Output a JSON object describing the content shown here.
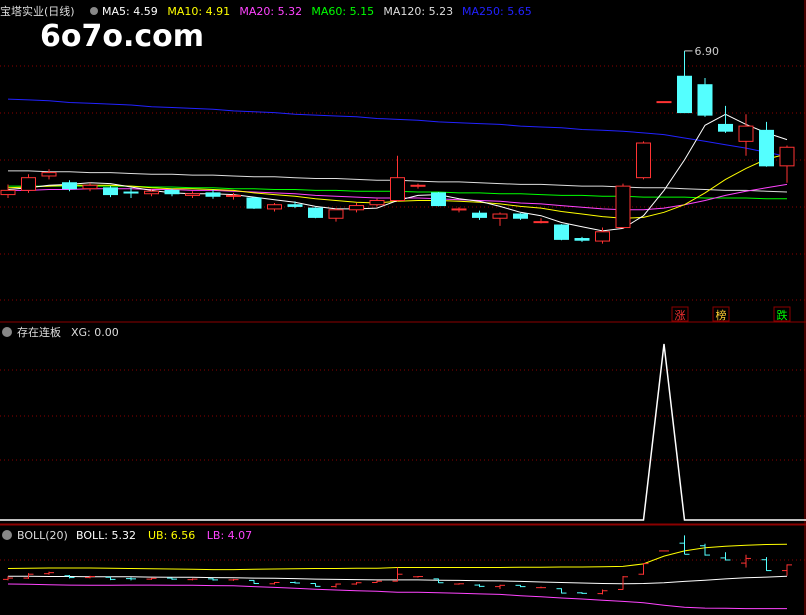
{
  "watermark": "6o7o.com",
  "main_panel": {
    "stock_name": "宝塔实业(日线)",
    "ma_legend": [
      {
        "text": "MA5: 4.59",
        "color": "#ffffff"
      },
      {
        "text": "MA10: 4.91",
        "color": "#ffff00"
      },
      {
        "text": "MA20: 5.32",
        "color": "#ff44ff"
      },
      {
        "text": "MA60: 5.15",
        "color": "#00ff00"
      },
      {
        "text": "MA120: 5.23",
        "color": "#dddddd"
      },
      {
        "text": "MA250: 5.65",
        "color": "#2222ff"
      }
    ],
    "high_label": "6.90",
    "tags": [
      {
        "text": "涨",
        "color": "#ff3333",
        "bg": "#8b0000"
      },
      {
        "text": "榜",
        "color": "#ffcc33",
        "bg": "#8b0000"
      },
      {
        "text": "跌",
        "color": "#00ff00",
        "bg": "#8b0000"
      }
    ]
  },
  "xg_panel": {
    "title": "存在连板",
    "legend": "XG: 0.00"
  },
  "boll_panel": {
    "title": "BOLL(20)",
    "legend": [
      {
        "text": "BOLL: 5.32",
        "color": "#ffffff"
      },
      {
        "text": "UB: 6.56",
        "color": "#ffff00"
      },
      {
        "text": "LB: 4.07",
        "color": "#ff44ff"
      }
    ]
  },
  "colors": {
    "up": "#ff3333",
    "down": "#54ffff",
    "grid": "#8b0000",
    "ma5": "#ffffff",
    "ma10": "#ffff00",
    "ma20": "#ff44ff",
    "ma60": "#00ff00",
    "ma120": "#dddddd",
    "ma250": "#2222ff"
  },
  "chart_data": {
    "type": "candlestick",
    "ylim": [
      4.0,
      7.1
    ],
    "candles": [
      {
        "o": 5.2,
        "c": 5.25,
        "h": 5.32,
        "l": 5.16
      },
      {
        "o": 5.25,
        "c": 5.4,
        "h": 5.44,
        "l": 5.22
      },
      {
        "o": 5.42,
        "c": 5.46,
        "h": 5.5,
        "l": 5.38
      },
      {
        "o": 5.34,
        "c": 5.27,
        "h": 5.37,
        "l": 5.24
      },
      {
        "o": 5.27,
        "c": 5.31,
        "h": 5.34,
        "l": 5.24
      },
      {
        "o": 5.28,
        "c": 5.2,
        "h": 5.3,
        "l": 5.17
      },
      {
        "o": 5.23,
        "c": 5.22,
        "h": 5.28,
        "l": 5.16
      },
      {
        "o": 5.21,
        "c": 5.24,
        "h": 5.26,
        "l": 5.18
      },
      {
        "o": 5.25,
        "c": 5.21,
        "h": 5.27,
        "l": 5.18
      },
      {
        "o": 5.19,
        "c": 5.21,
        "h": 5.24,
        "l": 5.16
      },
      {
        "o": 5.22,
        "c": 5.18,
        "h": 5.26,
        "l": 5.15
      },
      {
        "o": 5.18,
        "c": 5.19,
        "h": 5.22,
        "l": 5.14
      },
      {
        "o": 5.16,
        "c": 5.04,
        "h": 5.17,
        "l": 5.03
      },
      {
        "o": 5.03,
        "c": 5.08,
        "h": 5.1,
        "l": 5.0
      },
      {
        "o": 5.08,
        "c": 5.06,
        "h": 5.12,
        "l": 5.04
      },
      {
        "o": 5.04,
        "c": 4.93,
        "h": 5.05,
        "l": 4.92
      },
      {
        "o": 4.92,
        "c": 5.02,
        "h": 5.04,
        "l": 4.88
      },
      {
        "o": 5.02,
        "c": 5.07,
        "h": 5.1,
        "l": 4.99
      },
      {
        "o": 5.08,
        "c": 5.13,
        "h": 5.15,
        "l": 5.06
      },
      {
        "o": 5.13,
        "c": 5.4,
        "h": 5.66,
        "l": 5.12
      },
      {
        "o": 5.3,
        "c": 5.31,
        "h": 5.33,
        "l": 5.27
      },
      {
        "o": 5.22,
        "c": 5.07,
        "h": 5.23,
        "l": 5.06
      },
      {
        "o": 5.02,
        "c": 5.03,
        "h": 5.05,
        "l": 4.99
      },
      {
        "o": 4.98,
        "c": 4.93,
        "h": 5.01,
        "l": 4.9
      },
      {
        "o": 4.92,
        "c": 4.97,
        "h": 4.99,
        "l": 4.83
      },
      {
        "o": 4.97,
        "c": 4.92,
        "h": 4.98,
        "l": 4.9
      },
      {
        "o": 4.88,
        "c": 4.88,
        "h": 4.92,
        "l": 4.86
      },
      {
        "o": 4.84,
        "c": 4.67,
        "h": 4.85,
        "l": 4.66
      },
      {
        "o": 4.68,
        "c": 4.66,
        "h": 4.7,
        "l": 4.64
      },
      {
        "o": 4.65,
        "c": 4.76,
        "h": 4.81,
        "l": 4.62
      },
      {
        "o": 4.81,
        "c": 5.3,
        "h": 5.33,
        "l": 4.8
      },
      {
        "o": 5.4,
        "c": 5.81,
        "h": 5.83,
        "l": 5.38
      },
      {
        "o": 6.3,
        "c": 6.3,
        "h": 6.3,
        "l": 6.3
      },
      {
        "o": 6.6,
        "c": 6.17,
        "h": 6.9,
        "l": 6.17
      },
      {
        "o": 6.5,
        "c": 6.14,
        "h": 6.58,
        "l": 6.12
      },
      {
        "o": 6.03,
        "c": 5.95,
        "h": 6.25,
        "l": 5.93
      },
      {
        "o": 5.83,
        "c": 6.01,
        "h": 6.15,
        "l": 5.66
      },
      {
        "o": 5.96,
        "c": 5.54,
        "h": 6.06,
        "l": 5.53
      },
      {
        "o": 5.54,
        "c": 5.76,
        "h": 5.78,
        "l": 5.34
      }
    ],
    "ma5": [
      5.26,
      5.28,
      5.31,
      5.32,
      5.34,
      5.33,
      5.29,
      5.25,
      5.22,
      5.21,
      5.21,
      5.2,
      5.17,
      5.14,
      5.11,
      5.06,
      5.03,
      5.03,
      5.04,
      5.13,
      5.19,
      5.2,
      5.15,
      5.12,
      5.06,
      4.99,
      4.95,
      4.87,
      4.82,
      4.77,
      4.8,
      4.95,
      5.25,
      5.61,
      6.02,
      6.15,
      6.03,
      5.93,
      5.85
    ],
    "ma10": [
      5.28,
      5.29,
      5.3,
      5.31,
      5.31,
      5.31,
      5.3,
      5.28,
      5.27,
      5.27,
      5.26,
      5.25,
      5.22,
      5.2,
      5.18,
      5.15,
      5.13,
      5.11,
      5.1,
      5.12,
      5.13,
      5.13,
      5.12,
      5.11,
      5.09,
      5.06,
      5.04,
      5.0,
      4.97,
      4.94,
      4.92,
      4.93,
      4.99,
      5.08,
      5.22,
      5.38,
      5.51,
      5.62,
      5.68
    ],
    "ma20": [
      5.25,
      5.25,
      5.26,
      5.26,
      5.27,
      5.27,
      5.27,
      5.26,
      5.26,
      5.25,
      5.25,
      5.24,
      5.23,
      5.22,
      5.21,
      5.19,
      5.18,
      5.17,
      5.16,
      5.16,
      5.16,
      5.15,
      5.14,
      5.13,
      5.12,
      5.1,
      5.09,
      5.07,
      5.05,
      5.03,
      5.02,
      5.02,
      5.04,
      5.08,
      5.13,
      5.19,
      5.24,
      5.28,
      5.32
    ],
    "ma60": [
      5.3,
      5.3,
      5.3,
      5.3,
      5.3,
      5.3,
      5.3,
      5.29,
      5.29,
      5.28,
      5.28,
      5.27,
      5.27,
      5.26,
      5.26,
      5.25,
      5.25,
      5.24,
      5.24,
      5.24,
      5.23,
      5.23,
      5.22,
      5.22,
      5.21,
      5.21,
      5.2,
      5.19,
      5.19,
      5.18,
      5.18,
      5.17,
      5.17,
      5.17,
      5.16,
      5.16,
      5.16,
      5.15,
      5.15
    ],
    "ma120": [
      5.48,
      5.48,
      5.47,
      5.47,
      5.46,
      5.46,
      5.45,
      5.44,
      5.44,
      5.43,
      5.43,
      5.42,
      5.41,
      5.41,
      5.4,
      5.39,
      5.39,
      5.38,
      5.37,
      5.37,
      5.36,
      5.35,
      5.35,
      5.34,
      5.33,
      5.32,
      5.32,
      5.31,
      5.3,
      5.3,
      5.29,
      5.28,
      5.28,
      5.27,
      5.26,
      5.25,
      5.25,
      5.24,
      5.23
    ],
    "ma250": [
      6.33,
      6.32,
      6.31,
      6.29,
      6.28,
      6.27,
      6.26,
      6.24,
      6.23,
      6.22,
      6.21,
      6.19,
      6.18,
      6.17,
      6.15,
      6.14,
      6.13,
      6.12,
      6.1,
      6.09,
      6.08,
      6.06,
      6.05,
      6.04,
      6.03,
      6.01,
      6.0,
      5.99,
      5.97,
      5.96,
      5.95,
      5.93,
      5.91,
      5.87,
      5.83,
      5.79,
      5.75,
      5.7,
      5.65
    ],
    "xg": [
      0,
      0,
      0,
      0,
      0,
      0,
      0,
      0,
      0,
      0,
      0,
      0,
      0,
      0,
      0,
      0,
      0,
      0,
      0,
      0,
      0,
      0,
      0,
      0,
      0,
      0,
      0,
      0,
      0,
      0,
      0,
      0,
      1,
      0,
      0,
      0,
      0,
      0,
      0
    ],
    "xg_ylim": [
      0,
      1
    ],
    "boll_ylim": [
      3.9,
      6.8
    ],
    "boll_mid": [
      5.32,
      5.32,
      5.31,
      5.31,
      5.3,
      5.3,
      5.3,
      5.29,
      5.28,
      5.28,
      5.27,
      5.26,
      5.25,
      5.24,
      5.23,
      5.21,
      5.2,
      5.19,
      5.18,
      5.18,
      5.18,
      5.17,
      5.16,
      5.15,
      5.14,
      5.12,
      5.1,
      5.08,
      5.06,
      5.04,
      5.03,
      5.04,
      5.07,
      5.12,
      5.17,
      5.22,
      5.26,
      5.29,
      5.32
    ],
    "boll_ub": [
      5.62,
      5.63,
      5.64,
      5.64,
      5.64,
      5.63,
      5.62,
      5.61,
      5.6,
      5.59,
      5.58,
      5.58,
      5.59,
      5.6,
      5.61,
      5.62,
      5.62,
      5.63,
      5.63,
      5.66,
      5.66,
      5.66,
      5.66,
      5.66,
      5.66,
      5.67,
      5.67,
      5.68,
      5.68,
      5.69,
      5.7,
      5.8,
      6.1,
      6.3,
      6.42,
      6.48,
      6.52,
      6.55,
      6.56
    ],
    "boll_lb": [
      5.02,
      5.01,
      4.99,
      4.98,
      4.97,
      4.97,
      4.98,
      4.98,
      4.97,
      4.97,
      4.96,
      4.95,
      4.92,
      4.89,
      4.86,
      4.82,
      4.79,
      4.76,
      4.74,
      4.7,
      4.7,
      4.68,
      4.66,
      4.64,
      4.62,
      4.57,
      4.53,
      4.48,
      4.44,
      4.39,
      4.35,
      4.3,
      4.2,
      4.12,
      4.09,
      4.08,
      4.07,
      4.07,
      4.07
    ]
  }
}
